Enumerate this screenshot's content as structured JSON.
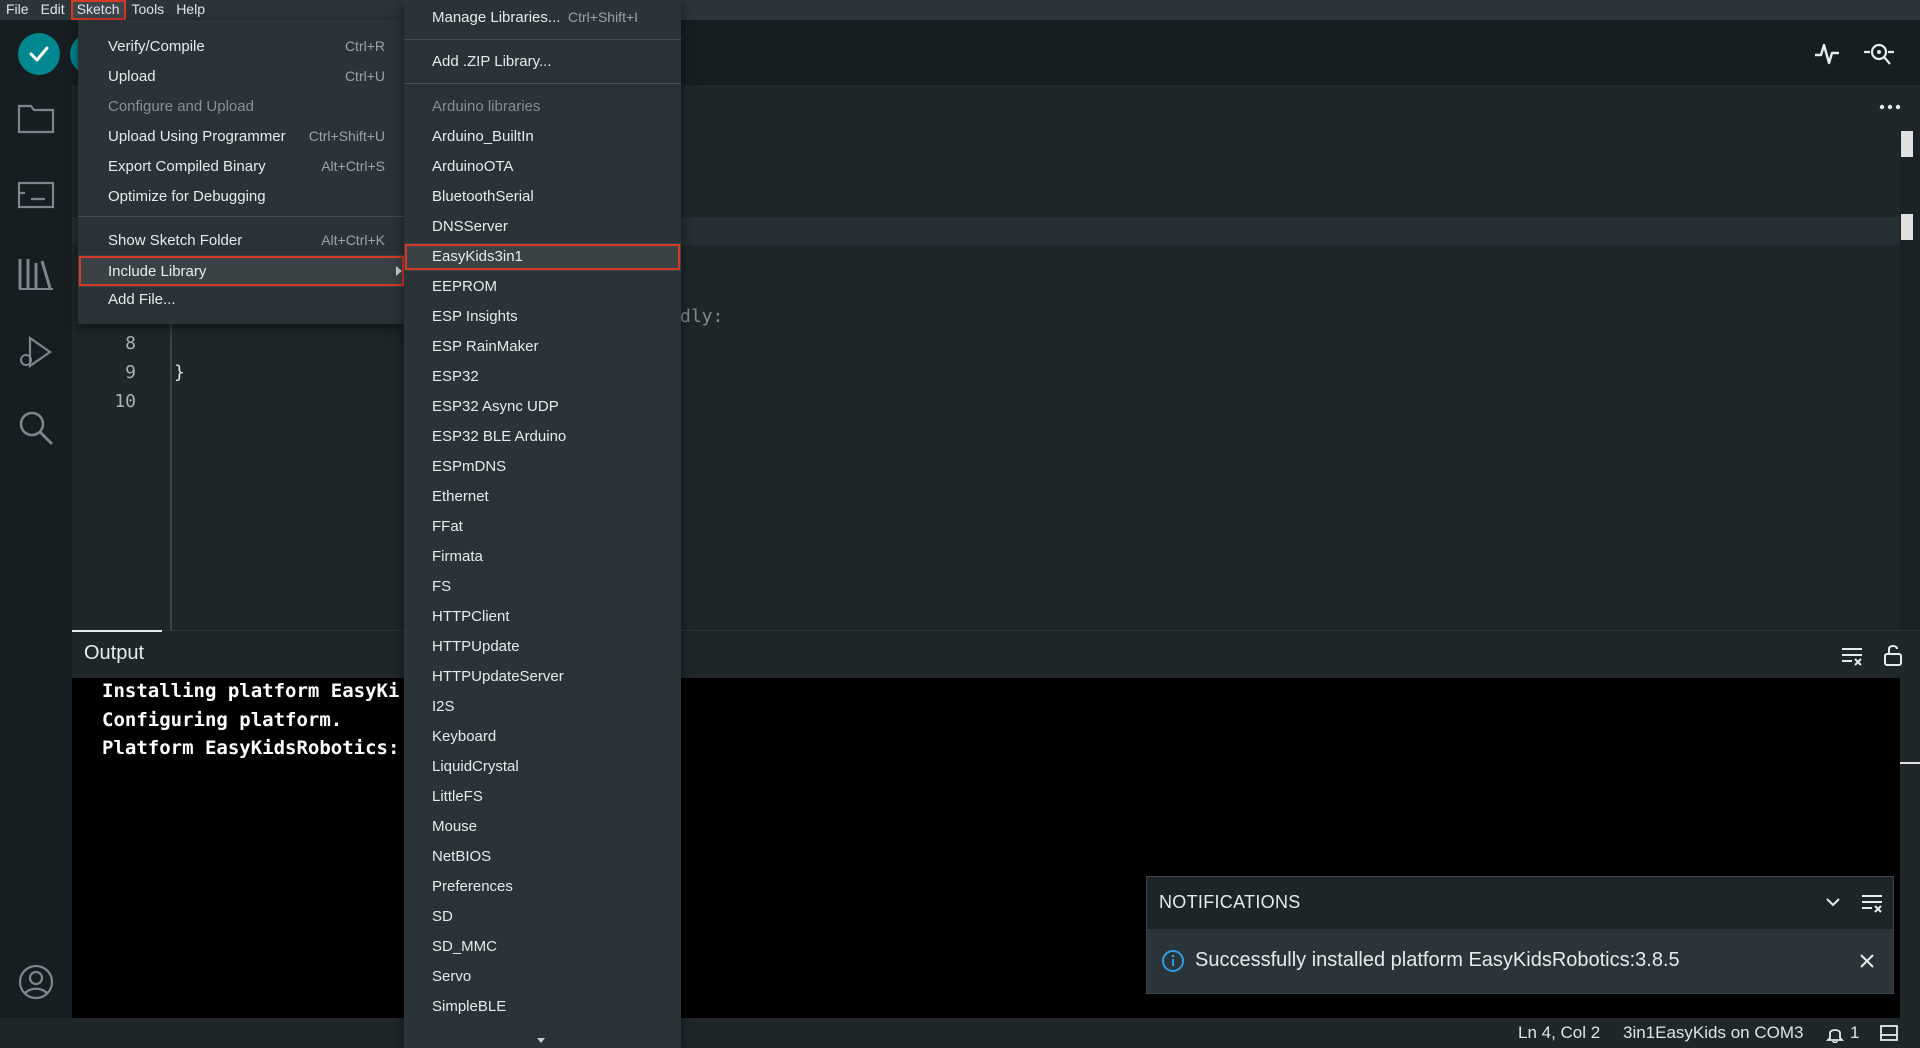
{
  "menubar": {
    "items": [
      "File",
      "Edit",
      "Sketch",
      "Tools",
      "Help"
    ],
    "active": "Sketch"
  },
  "editor": {
    "line_numbers": [
      "8",
      "9",
      "10"
    ],
    "visible_code_closing_brace": "}",
    "comment_fragment": "dly:"
  },
  "sketch_menu": {
    "items": [
      {
        "label": "Verify/Compile",
        "shortcut": "Ctrl+R"
      },
      {
        "label": "Upload",
        "shortcut": "Ctrl+U"
      },
      {
        "label": "Configure and Upload",
        "shortcut": "",
        "disabled": true
      },
      {
        "label": "Upload Using Programmer",
        "shortcut": "Ctrl+Shift+U"
      },
      {
        "label": "Export Compiled Binary",
        "shortcut": "Alt+Ctrl+S"
      },
      {
        "label": "Optimize for Debugging",
        "shortcut": ""
      },
      {
        "label": "Show Sketch Folder",
        "shortcut": "Alt+Ctrl+K"
      },
      {
        "label": "Include Library",
        "shortcut": "",
        "selected": true,
        "submenu": true
      },
      {
        "label": "Add File...",
        "shortcut": ""
      }
    ]
  },
  "library_menu": {
    "manage": {
      "label": "Manage Libraries...",
      "shortcut": "Ctrl+Shift+I"
    },
    "add_zip": {
      "label": "Add .ZIP Library..."
    },
    "section_header": "Arduino libraries",
    "libraries": [
      "Arduino_BuiltIn",
      "ArduinoOTA",
      "BluetoothSerial",
      "DNSServer",
      "EasyKids3in1",
      "EEPROM",
      "ESP Insights",
      "ESP RainMaker",
      "ESP32",
      "ESP32 Async UDP",
      "ESP32 BLE Arduino",
      "ESPmDNS",
      "Ethernet",
      "FFat",
      "Firmata",
      "FS",
      "HTTPClient",
      "HTTPUpdate",
      "HTTPUpdateServer",
      "I2S",
      "Keyboard",
      "LiquidCrystal",
      "LittleFS",
      "Mouse",
      "NetBIOS",
      "Preferences",
      "SD",
      "SD_MMC",
      "Servo",
      "SimpleBLE"
    ],
    "selected": "EasyKids3in1"
  },
  "output": {
    "title": "Output",
    "lines": [
      "Installing platform EasyKi",
      "Configuring platform.",
      "Platform EasyKidsRobotics:"
    ]
  },
  "notifications": {
    "title": "NOTIFICATIONS",
    "message": "Successfully installed platform EasyKidsRobotics:3.8.5"
  },
  "statusbar": {
    "position": "Ln 4, Col 2",
    "board": "3in1EasyKids on COM3",
    "notif_count": "1"
  },
  "colors": {
    "accent": "#00878f",
    "highlight_border": "#d43a24",
    "info": "#2f9ee0"
  }
}
